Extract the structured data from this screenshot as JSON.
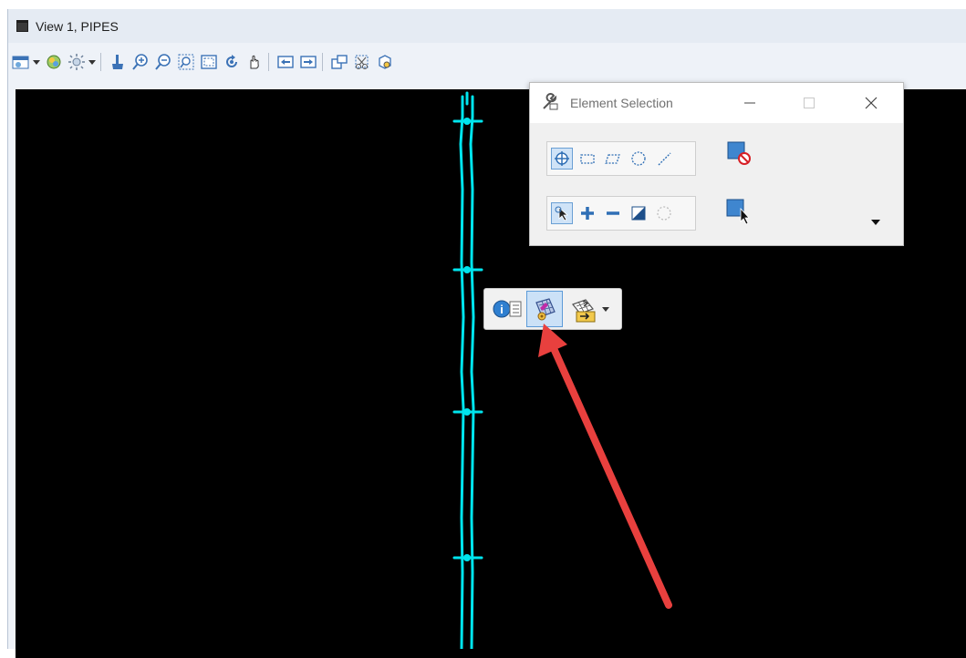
{
  "window": {
    "title": "View 1, PIPES"
  },
  "toolbar": {
    "items": [
      "view-attributes-icon",
      "dropdown-arrow",
      "display-style-icon",
      "lighting-icon",
      "dropdown-arrow",
      "update-view-icon",
      "zoom-in-icon",
      "zoom-out-icon",
      "window-area-icon",
      "fit-view-icon",
      "rotate-view-icon",
      "pan-view-icon",
      "view-previous-icon",
      "view-next-icon",
      "copy-view-icon",
      "clip-volume-icon",
      "clip-mask-icon"
    ]
  },
  "element_selection": {
    "title": "Element Selection",
    "method_icons": [
      "individual-select-icon",
      "block-select-icon",
      "shape-select-icon",
      "circle-select-icon",
      "line-select-icon"
    ],
    "mode_icons": [
      "new-mode-icon",
      "add-mode-icon",
      "subtract-mode-icon",
      "invert-mode-icon",
      "clear-mode-icon"
    ],
    "clear_button_icon": "clear-selection-icon",
    "select_all_icon": "select-all-icon"
  },
  "context_toolbar": {
    "items": [
      "properties-icon",
      "edit-element-icon",
      "move-element-icon"
    ]
  },
  "colors": {
    "pipe": "#00e5ee",
    "arrow": "#e8403e",
    "viewport_bg": "#000000"
  }
}
